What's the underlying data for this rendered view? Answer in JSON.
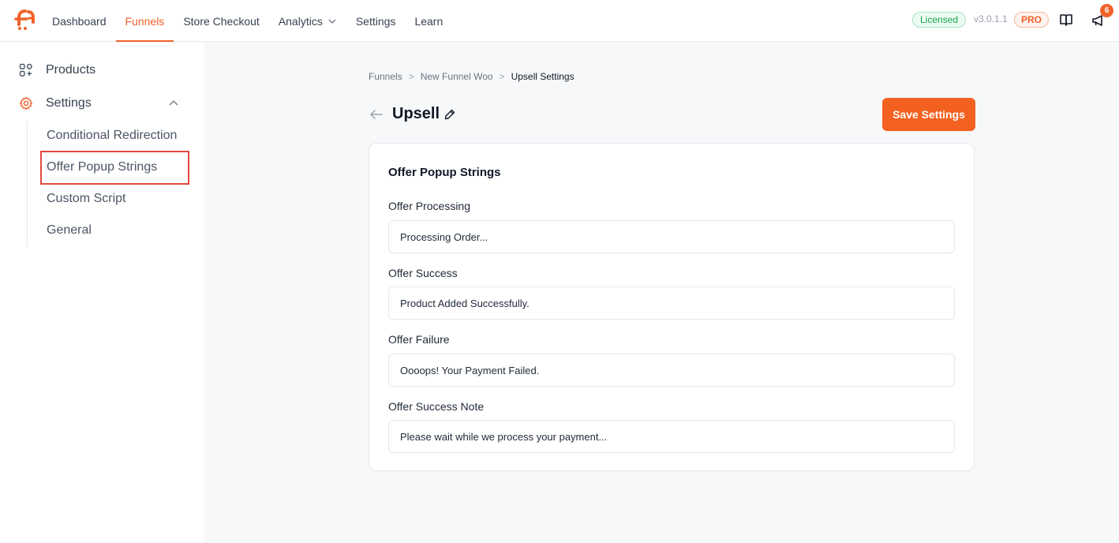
{
  "nav": {
    "items": [
      {
        "label": "Dashboard",
        "active": false
      },
      {
        "label": "Funnels",
        "active": true
      },
      {
        "label": "Store Checkout",
        "active": false
      },
      {
        "label": "Analytics",
        "active": false,
        "has_dropdown": true
      },
      {
        "label": "Settings",
        "active": false
      },
      {
        "label": "Learn",
        "active": false
      }
    ],
    "license_badge": "Licensed",
    "version": "v3.0.1.1",
    "pro_badge": "PRO",
    "notification_count": "6",
    "icons": [
      "logo-icon",
      "chevron-down-icon",
      "book-icon",
      "megaphone-icon"
    ]
  },
  "sidebar": {
    "products_label": "Products",
    "settings_label": "Settings",
    "sub_items": [
      {
        "label": "Conditional Redirection",
        "selected": false
      },
      {
        "label": "Offer Popup Strings",
        "selected": true
      },
      {
        "label": "Custom Script",
        "selected": false
      },
      {
        "label": "General",
        "selected": false
      }
    ]
  },
  "breadcrumb": {
    "items": [
      "Funnels",
      "New Funnel Woo",
      "Upsell Settings"
    ],
    "separator": ">"
  },
  "header": {
    "title": "Upsell",
    "save_label": "Save Settings"
  },
  "card": {
    "title": "Offer Popup Strings",
    "fields": [
      {
        "label": "Offer Processing",
        "value": "Processing Order..."
      },
      {
        "label": "Offer Success",
        "value": "Product Added Successfully."
      },
      {
        "label": "Offer Failure",
        "value": "Oooops! Your Payment Failed."
      },
      {
        "label": "Offer Success Note",
        "value": "Please wait while we process your payment..."
      }
    ]
  },
  "colors": {
    "accent": "#f06129",
    "button": "#f4601f",
    "highlight_border": "#e2473f",
    "licensed_green": "#16a34a"
  }
}
